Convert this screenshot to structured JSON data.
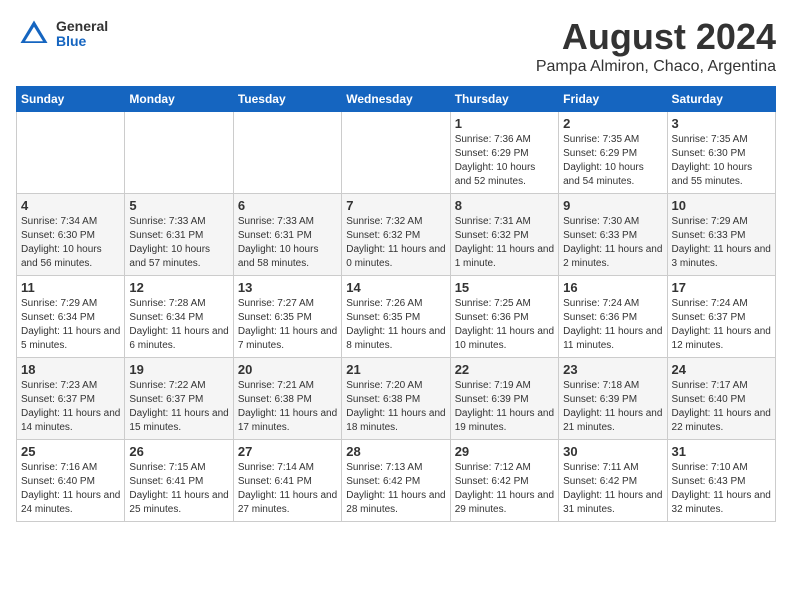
{
  "header": {
    "logo_general": "General",
    "logo_blue": "Blue",
    "title": "August 2024",
    "subtitle": "Pampa Almiron, Chaco, Argentina"
  },
  "days_of_week": [
    "Sunday",
    "Monday",
    "Tuesday",
    "Wednesday",
    "Thursday",
    "Friday",
    "Saturday"
  ],
  "weeks": [
    [
      {
        "day": "",
        "info": ""
      },
      {
        "day": "",
        "info": ""
      },
      {
        "day": "",
        "info": ""
      },
      {
        "day": "",
        "info": ""
      },
      {
        "day": "1",
        "info": "Sunrise: 7:36 AM\nSunset: 6:29 PM\nDaylight: 10 hours and 52 minutes."
      },
      {
        "day": "2",
        "info": "Sunrise: 7:35 AM\nSunset: 6:29 PM\nDaylight: 10 hours and 54 minutes."
      },
      {
        "day": "3",
        "info": "Sunrise: 7:35 AM\nSunset: 6:30 PM\nDaylight: 10 hours and 55 minutes."
      }
    ],
    [
      {
        "day": "4",
        "info": "Sunrise: 7:34 AM\nSunset: 6:30 PM\nDaylight: 10 hours and 56 minutes."
      },
      {
        "day": "5",
        "info": "Sunrise: 7:33 AM\nSunset: 6:31 PM\nDaylight: 10 hours and 57 minutes."
      },
      {
        "day": "6",
        "info": "Sunrise: 7:33 AM\nSunset: 6:31 PM\nDaylight: 10 hours and 58 minutes."
      },
      {
        "day": "7",
        "info": "Sunrise: 7:32 AM\nSunset: 6:32 PM\nDaylight: 11 hours and 0 minutes."
      },
      {
        "day": "8",
        "info": "Sunrise: 7:31 AM\nSunset: 6:32 PM\nDaylight: 11 hours and 1 minute."
      },
      {
        "day": "9",
        "info": "Sunrise: 7:30 AM\nSunset: 6:33 PM\nDaylight: 11 hours and 2 minutes."
      },
      {
        "day": "10",
        "info": "Sunrise: 7:29 AM\nSunset: 6:33 PM\nDaylight: 11 hours and 3 minutes."
      }
    ],
    [
      {
        "day": "11",
        "info": "Sunrise: 7:29 AM\nSunset: 6:34 PM\nDaylight: 11 hours and 5 minutes."
      },
      {
        "day": "12",
        "info": "Sunrise: 7:28 AM\nSunset: 6:34 PM\nDaylight: 11 hours and 6 minutes."
      },
      {
        "day": "13",
        "info": "Sunrise: 7:27 AM\nSunset: 6:35 PM\nDaylight: 11 hours and 7 minutes."
      },
      {
        "day": "14",
        "info": "Sunrise: 7:26 AM\nSunset: 6:35 PM\nDaylight: 11 hours and 8 minutes."
      },
      {
        "day": "15",
        "info": "Sunrise: 7:25 AM\nSunset: 6:36 PM\nDaylight: 11 hours and 10 minutes."
      },
      {
        "day": "16",
        "info": "Sunrise: 7:24 AM\nSunset: 6:36 PM\nDaylight: 11 hours and 11 minutes."
      },
      {
        "day": "17",
        "info": "Sunrise: 7:24 AM\nSunset: 6:37 PM\nDaylight: 11 hours and 12 minutes."
      }
    ],
    [
      {
        "day": "18",
        "info": "Sunrise: 7:23 AM\nSunset: 6:37 PM\nDaylight: 11 hours and 14 minutes."
      },
      {
        "day": "19",
        "info": "Sunrise: 7:22 AM\nSunset: 6:37 PM\nDaylight: 11 hours and 15 minutes."
      },
      {
        "day": "20",
        "info": "Sunrise: 7:21 AM\nSunset: 6:38 PM\nDaylight: 11 hours and 17 minutes."
      },
      {
        "day": "21",
        "info": "Sunrise: 7:20 AM\nSunset: 6:38 PM\nDaylight: 11 hours and 18 minutes."
      },
      {
        "day": "22",
        "info": "Sunrise: 7:19 AM\nSunset: 6:39 PM\nDaylight: 11 hours and 19 minutes."
      },
      {
        "day": "23",
        "info": "Sunrise: 7:18 AM\nSunset: 6:39 PM\nDaylight: 11 hours and 21 minutes."
      },
      {
        "day": "24",
        "info": "Sunrise: 7:17 AM\nSunset: 6:40 PM\nDaylight: 11 hours and 22 minutes."
      }
    ],
    [
      {
        "day": "25",
        "info": "Sunrise: 7:16 AM\nSunset: 6:40 PM\nDaylight: 11 hours and 24 minutes."
      },
      {
        "day": "26",
        "info": "Sunrise: 7:15 AM\nSunset: 6:41 PM\nDaylight: 11 hours and 25 minutes."
      },
      {
        "day": "27",
        "info": "Sunrise: 7:14 AM\nSunset: 6:41 PM\nDaylight: 11 hours and 27 minutes."
      },
      {
        "day": "28",
        "info": "Sunrise: 7:13 AM\nSunset: 6:42 PM\nDaylight: 11 hours and 28 minutes."
      },
      {
        "day": "29",
        "info": "Sunrise: 7:12 AM\nSunset: 6:42 PM\nDaylight: 11 hours and 29 minutes."
      },
      {
        "day": "30",
        "info": "Sunrise: 7:11 AM\nSunset: 6:42 PM\nDaylight: 11 hours and 31 minutes."
      },
      {
        "day": "31",
        "info": "Sunrise: 7:10 AM\nSunset: 6:43 PM\nDaylight: 11 hours and 32 minutes."
      }
    ]
  ]
}
